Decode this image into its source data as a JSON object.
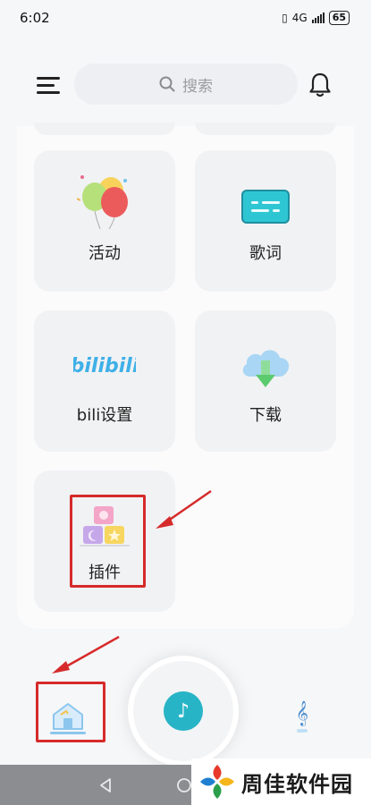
{
  "status": {
    "time": "6:02",
    "network": "4G",
    "battery": "65"
  },
  "header": {
    "search_placeholder": "搜索"
  },
  "tiles": [
    {
      "label": "活动",
      "icon": "balloons-icon"
    },
    {
      "label": "歌词",
      "icon": "lyrics-icon"
    },
    {
      "label": "bili设置",
      "icon": "bilibili-icon"
    },
    {
      "label": "下载",
      "icon": "cloud-download-icon"
    },
    {
      "label": "插件",
      "icon": "plugin-blocks-icon"
    }
  ],
  "bili_logo_text": "bilibili",
  "bottom_nav": {
    "home": "home-icon",
    "play": "music-note-icon",
    "library": "treble-clef-icon"
  },
  "watermark": {
    "text": "周佳软件园"
  },
  "colors": {
    "accent": "#27b4c6",
    "highlight_box": "#d62a2a",
    "tile_bg": "#f1f2f4"
  }
}
